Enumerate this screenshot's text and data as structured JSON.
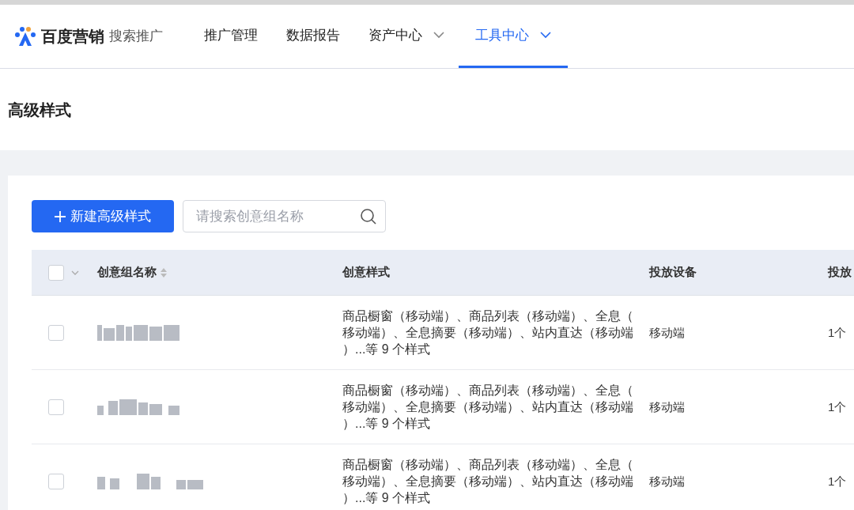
{
  "brand": {
    "name": "百度营销",
    "product": "搜索推广"
  },
  "nav": [
    {
      "label": "推广管理",
      "selected": false,
      "dropdown": false
    },
    {
      "label": "数据报告",
      "selected": false,
      "dropdown": false
    },
    {
      "label": "资产中心",
      "selected": false,
      "dropdown": true
    },
    {
      "label": "工具中心",
      "selected": true,
      "dropdown": true
    }
  ],
  "page_title": "高级样式",
  "toolbar": {
    "new_button": "新建高级样式",
    "search": {
      "placeholder": "请搜索创意组名称"
    }
  },
  "table": {
    "select_all": {
      "checked": false
    },
    "columns": [
      {
        "label": "创意组名称",
        "sortable": true
      },
      {
        "label": "创意样式",
        "sortable": false
      },
      {
        "label": "投放设备",
        "sortable": false
      },
      {
        "label": "投放"
      }
    ],
    "rows": [
      {
        "checked": false,
        "style": "商品橱窗（移动端）、商品列表（移动端）、全息（移动端）、全息摘要（移动端）、站内直达（移动端）...等 9 个样式",
        "device": "移动端",
        "column_4": "1个"
      },
      {
        "checked": false,
        "style": "商品橱窗（移动端）、商品列表（移动端）、全息（移动端）、全息摘要（移动端）、站内直达（移动端）...等 9 个样式",
        "device": "移动端",
        "column_4": "1个"
      },
      {
        "checked": false,
        "style": "商品橱窗（移动端）、商品列表（移动端）、全息（移动端）、全息摘要（移动端）、站内直达（移动端）...等 9 个样式",
        "device": "移动端",
        "column_4": "1个"
      }
    ]
  }
}
